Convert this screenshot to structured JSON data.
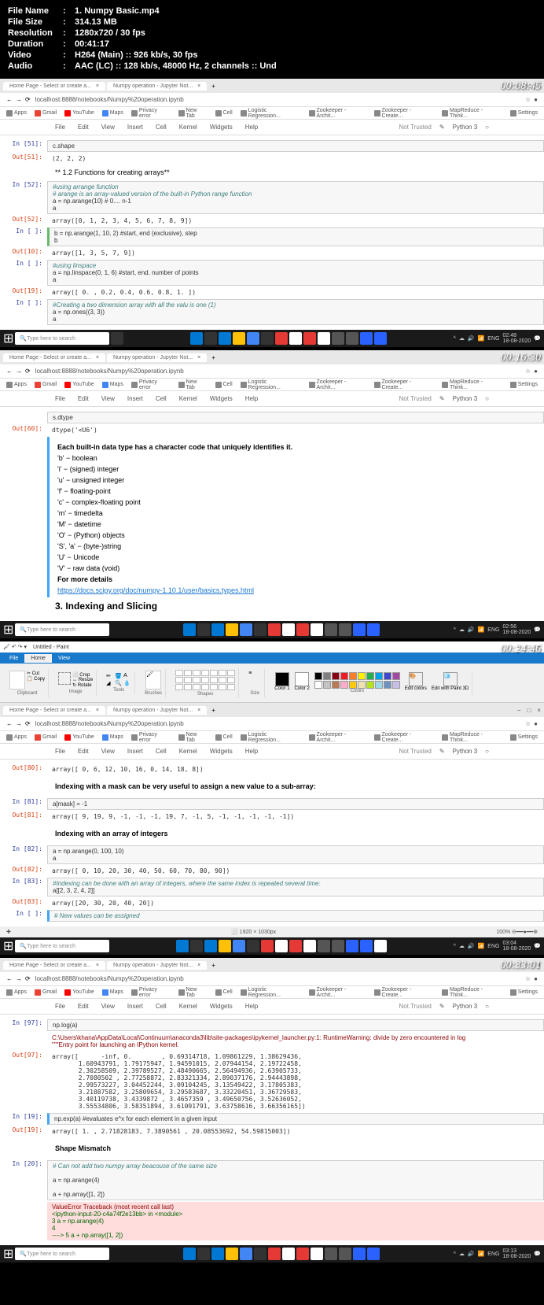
{
  "header": {
    "filename_label": "File Name",
    "filename": "1. Numpy Basic.mp4",
    "filesize_label": "File Size",
    "filesize": "314.13 MB",
    "resolution_label": "Resolution",
    "resolution": "1280x720 / 30 fps",
    "duration_label": "Duration",
    "duration": "00:41:17",
    "video_label": "Video",
    "video": "H264 (Main) :: 926 kb/s, 30 fps",
    "audio_label": "Audio",
    "audio": "AAC (LC) :: 128 kb/s, 48000 Hz, 2 channels :: Und"
  },
  "browser": {
    "tab1": "Home Page - Select or create a...",
    "tab2": "Numpy operation - Jupyter Not...",
    "url": "localhost:8888/notebooks/Numpy%20operation.ipynb",
    "bookmarks": [
      "Apps",
      "Gmail",
      "YouTube",
      "Maps",
      "Privacy error",
      "New Tab",
      "Cell",
      "Logistic Regression...",
      "Zookeeper - Archit...",
      "Zookeeper - Create...",
      "MapReduce - Think...",
      "Settings"
    ]
  },
  "jupyter": {
    "menu": [
      "File",
      "Edit",
      "View",
      "Insert",
      "Cell",
      "Kernel",
      "Widgets",
      "Help"
    ],
    "not_trusted": "Not Trusted",
    "python": "Python 3"
  },
  "frame1": {
    "timestamp": "00:08:45",
    "cells": {
      "in51": "In [51]:",
      "in51_code": "c.shape",
      "out51": "Out[51]:",
      "out51_val": "(2, 2, 2)",
      "md1": "** 1.2 Functions for creating arrays**",
      "in52": "In [52]:",
      "in52_c1": "#using arrange function",
      "in52_c2": "# arange is an array-valued version of the built-in Python range function",
      "in52_c3": "a = np.arange(10) # 0.... n-1",
      "in52_c4": "a",
      "out52": "Out[52]:",
      "out52_val": "array([0, 1, 2, 3, 4, 5, 6, 7, 8, 9])",
      "in_blank": "In [ ]:",
      "in_blank_code": "b = np.arange(1, 10, 2) #start, end (exclusive), step",
      "in_blank_code2": "b",
      "out10": "Out[10]:",
      "out10_val": "array([1, 3, 5, 7, 9])",
      "in_blank2_c1": "#using linspace",
      "in_blank2_c2": "a = np.linspace(0, 1, 6) #start, end, number of points",
      "in_blank2_c3": "a",
      "out19": "Out[19]:",
      "out19_val": "array([ 0. ,  0.2,  0.4,  0.6,  0.8,  1. ])",
      "in_blank3_c1": "#Creating a two dimension array with all the valu is one (1)",
      "in_blank3_c2": "a = np.ones((3, 3))",
      "in_blank3_c3": "a"
    },
    "clock": "02:48",
    "date": "18-08-2020"
  },
  "frame2": {
    "timestamp": "00:16:30",
    "cells": {
      "in_code": "s.dtype",
      "out60": "Out[60]:",
      "out60_val": "dtype('<U6')",
      "md_title": "Each built-in data type has a character code that uniquely identifies it.",
      "types": [
        "'b' − boolean",
        "'i' − (signed) integer",
        "'u' − unsigned integer",
        "'f' − floating-point",
        "'c' − complex-floating point",
        "'m' − timedelta",
        "'M' − datetime",
        "'O' − (Python) objects",
        "'S', 'a' − (byte-)string",
        "'U' − Unicode",
        "'V' − raw data (void)"
      ],
      "more": "For more details",
      "link": "https://docs.scipy.org/doc/numpy-1.10.1/user/basics.types.html",
      "h3": "3. Indexing and Slicing"
    },
    "clock": "02:56",
    "date": "18-08-2020"
  },
  "frame3": {
    "timestamp": "00:24:46",
    "paint_title": "Untitled - Paint",
    "paint_tabs": [
      "File",
      "Home",
      "View"
    ],
    "ribbon_labels": [
      "Clipboard",
      "Image",
      "Tools",
      "Brushes",
      "Shapes",
      "Size",
      "Colors"
    ],
    "paint_status_dim": "1920 × 1030px",
    "paint_status_zoom": "100%",
    "cells": {
      "out80_val": "array([ 0,  6, 12, 10, 16,  0, 14, 18,  8])",
      "md1": "Indexing with a mask can be very useful to assign a new value to a sub-array:",
      "in81": "In [81]:",
      "in81_code": "a[mask] = -1",
      "out81": "Out[81]:",
      "out81_val": "array([ 9, 19,  9, -1, -1, -1, 19,  7, -1,  5, -1, -1, -1, -1, -1])",
      "md2": "Indexing with an array of integers",
      "in82": "In [82]:",
      "in82_c1": "a = np.arange(0, 100, 10)",
      "in82_c2": "a",
      "out82": "Out[82]:",
      "out82_val": "array([ 0, 10, 20, 30, 40, 50, 60, 70, 80, 90])",
      "in83": "In [83]:",
      "in83_c1": "#Indexing can be done with an array of integers, where the same index is repeated several time:",
      "in83_c2": "a[[2, 3, 2, 4, 2]]",
      "out83": "Out[83]:",
      "out83_val": "array([20, 30, 20, 40, 20])",
      "in_blank": "In [ ]:",
      "in_blank_c": "# New values can be assigned"
    },
    "clock": "03:04",
    "date": "18-08-2020"
  },
  "frame4": {
    "timestamp": "00:33:01",
    "cells": {
      "in97": "In [97]:",
      "in97_code": "np.log(a)",
      "warn1": "C:\\Users\\khana\\AppData\\Local\\Continuum\\anaconda3\\lib\\site-packages\\ipykernel_launcher.py:1: RuntimeWarning: divide by zero encountered in log",
      "warn2": "  \"\"\"Entry point for launching an IPython kernel.",
      "out97": "Out[97]:",
      "out97_val": "array([      -inf, 0.        , 0.69314718, 1.09861229, 1.38629436,\n       1.60943791, 1.79175947, 1.94591015, 2.07944154, 2.19722458,\n       2.30258509, 2.39789527, 2.48490665, 2.56494936, 2.63905733,\n       2.7080502 , 2.77258872, 2.83321334, 2.89037176, 2.94443898,\n       2.99573227, 3.04452244, 3.09104245, 3.13549422, 3.17805383,\n       3.21887582, 3.25809654, 3.29583687, 3.33220451, 3.36729583,\n       3.40119738, 3.4339872 , 3.4657359 , 3.49650756, 3.52636052,\n       3.55534806, 3.58351894, 3.61091791, 3.63758616, 3.66356165])",
      "in19": "In [19]:",
      "in19_code": "np.exp(a)    #evaluates e^x for each element in a given input",
      "out19": "Out[19]:",
      "out19_val": "array([ 1.        ,  2.71828183,  7.3890561 , 20.08553692, 54.59815003])",
      "md_h": "Shape Mismatch",
      "in20": "In [20]:",
      "in20_c1": "#   Can not add two numpy array beacouse of the same size",
      "in20_c2": "a = np.arange(4)",
      "in20_c3": "a + np.array([1, 2])",
      "err1": "ValueError                                Traceback (most recent call last)",
      "err2": "<ipython-input-20-c4a74f2e13bb> in <module>",
      "err3": "      3 a = np.arange(4)",
      "err4": "      4",
      "err5": "----> 5 a + np.array([1, 2])"
    },
    "clock": "03:13",
    "date": "18-08-2020"
  },
  "taskbar": {
    "search_ph": "Type here to search",
    "lang": "ENG"
  }
}
